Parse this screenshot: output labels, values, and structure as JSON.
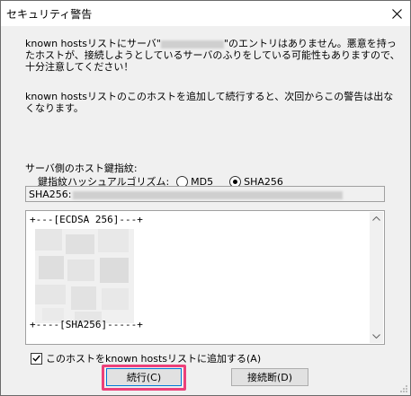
{
  "window": {
    "title": "セキュリティ警告",
    "close_icon": "close-icon"
  },
  "message": {
    "line1_a": "known hostsリストにサーバ\"",
    "line1_b": "\"のエントリはありません。悪意を持っ",
    "line2": "たホストが、接続しようとしているサーバのふりをしている可能性もありますので、",
    "line3": "十分注意してください！",
    "line4": "known hostsリストのこのホストを追加して続行すると、次回からこの警告は出な",
    "line5": "くなります。"
  },
  "fingerprint": {
    "label": "サーバ側のホスト鍵指紋:",
    "hash_label": "鍵指紋ハッシュアルゴリズム:",
    "options": [
      "MD5",
      "SHA256"
    ],
    "selected": "SHA256",
    "value_prefix": "SHA256:"
  },
  "randomart": {
    "top": "+---[ECDSA 256]---+",
    "bottom": "+----[SHA256]-----+"
  },
  "add_checkbox": {
    "label": "このホストをknown hostsリストに追加する(A)",
    "checked": true
  },
  "buttons": {
    "continue": "続行(C)",
    "disconnect": "接続断(D)"
  },
  "colors": {
    "highlight": "#ec407a",
    "focus": "#0078d7"
  }
}
